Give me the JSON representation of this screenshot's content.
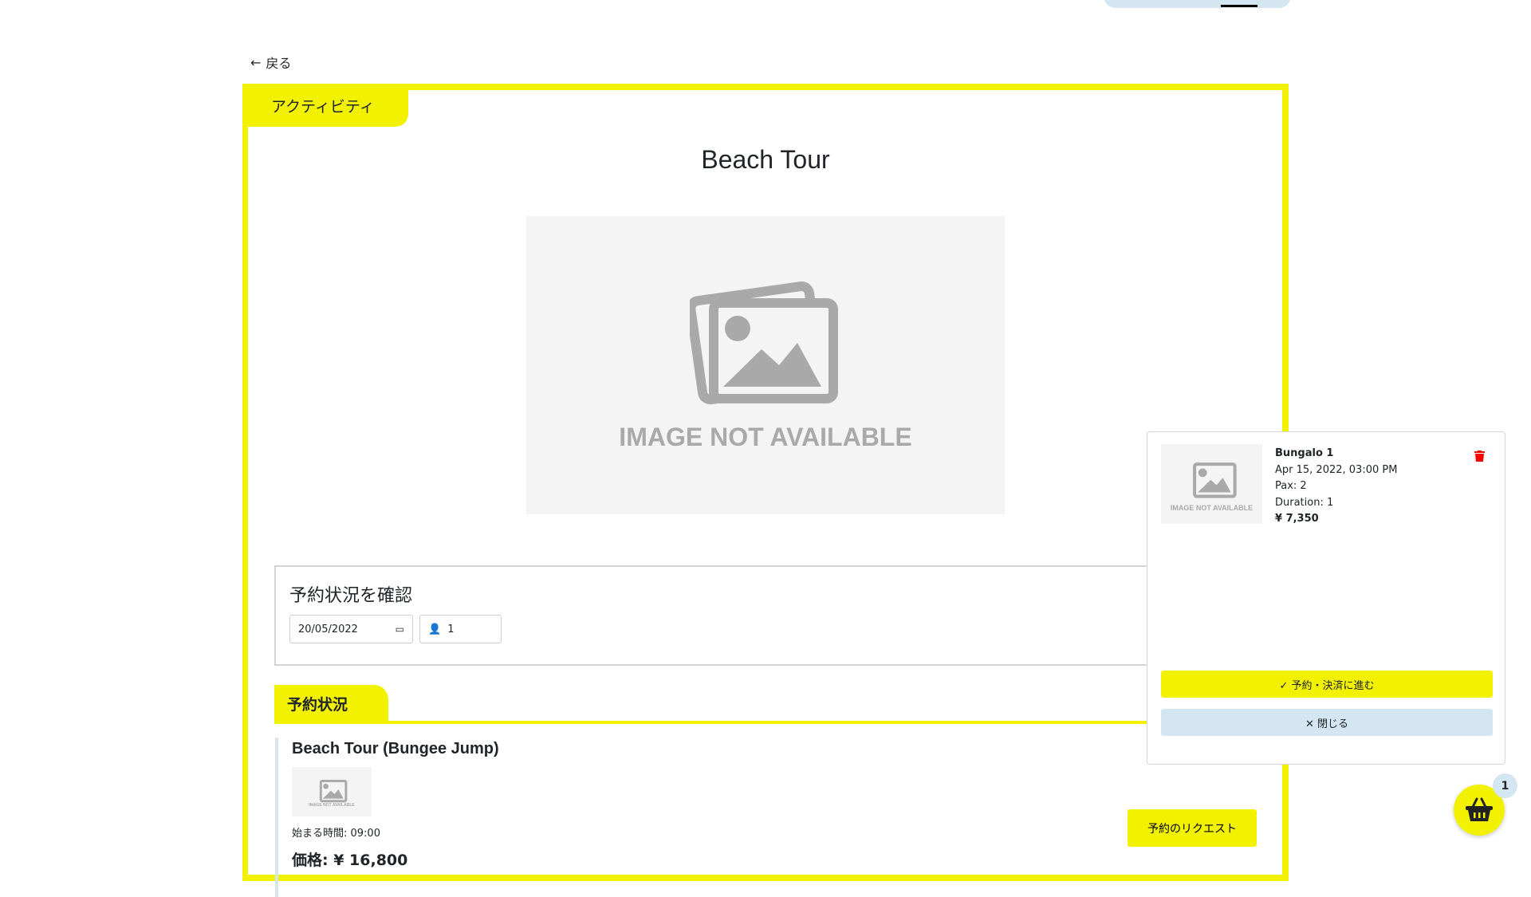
{
  "nav": {
    "back_label": "戻る"
  },
  "activity": {
    "tab_label": "アクティビティ",
    "title": "Beach Tour",
    "image_text": "IMAGE NOT AVAILABLE"
  },
  "availability": {
    "heading": "予約状況を確認",
    "date_value": "20/05/2022",
    "pax_value": "1"
  },
  "status": {
    "tab_label": "予約状況",
    "item": {
      "title": "Beach Tour (Bungee Jump)",
      "image_text": "IMAGE NOT AVAILABLE",
      "start_time": "始まる時間: 09:00",
      "price": "価格: ¥ 16,800",
      "request_label": "予約のリクエスト"
    }
  },
  "cart": {
    "item": {
      "name": "Bungalo 1",
      "datetime": "Apr 15, 2022, 03:00 PM",
      "pax": "Pax: 2",
      "duration": "Duration: 1",
      "price": "¥ 7,350",
      "image_text": "IMAGE NOT AVAILABLE"
    },
    "proceed_label": "✓ 予約・決済に進む",
    "close_label": "✕ 閉じる",
    "count": "1"
  },
  "colors": {
    "accent": "#f2f200",
    "secondary": "#d4e6f1",
    "danger": "#ff0000"
  }
}
